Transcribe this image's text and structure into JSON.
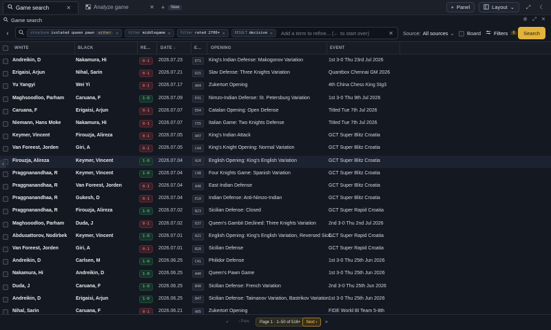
{
  "tabs": [
    {
      "label": "Game search",
      "active": true
    },
    {
      "label": "Analyze game",
      "active": false
    }
  ],
  "new_tab": {
    "plus": "+",
    "badge": "New"
  },
  "toolbar": {
    "panel_label": "Panel",
    "layout_label": "Layout"
  },
  "window": {
    "title": "Game search"
  },
  "search": {
    "chips": [
      {
        "key": "structure",
        "value": "isolated queen pawn",
        "mode": "either"
      },
      {
        "key": "filter",
        "value": "middlegame"
      },
      {
        "key": "filter",
        "value": "rated 2700+"
      },
      {
        "key": "RESULT",
        "value": "decisive"
      }
    ],
    "placeholder": "Add a term to refine... (← to start over)",
    "source_label": "Source:",
    "source_value": "All sources",
    "board_label": "Board",
    "filters_label": "Filters",
    "filters_count": "8",
    "search_button": "Search"
  },
  "columns": [
    "WHITE",
    "BLACK",
    "RE...",
    "DATE ↓",
    "E...",
    "OPENING",
    "EVENT"
  ],
  "rows": [
    {
      "white": "Andreikin, D",
      "black": "Nakamura, Hi",
      "result": "0-1",
      "date": "2026.07.23",
      "eco": "E71",
      "opening": "King's Indian Defense: Makogonov Variation",
      "event": "1st 3-0 Thu 23rd Jul 2026"
    },
    {
      "white": "Erigaisi, Arjun",
      "black": "Nihal, Sarin",
      "result": "0-1",
      "date": "2026.07.21",
      "eco": "D15",
      "opening": "Slav Defense: Three Knights Variation",
      "event": "Quantbox Chennai GM 2026"
    },
    {
      "white": "Yu Yangyi",
      "black": "Wei Yi",
      "result": "0-1",
      "date": "2026.07.17",
      "eco": "A04",
      "opening": "Zukertort Opening",
      "event": "4th China Chess King Stg3"
    },
    {
      "white": "Maghsoodloo, Parham",
      "black": "Caruana, F",
      "result": "1-0",
      "date": "2026.07.09",
      "eco": "E41",
      "opening": "Nimzo-Indian Defense: St. Petersburg Variation",
      "event": "1st 3-0 Thu 9th Jul 2026"
    },
    {
      "white": "Caruana, F",
      "black": "Erigaisi, Arjun",
      "result": "0-1",
      "date": "2026.07.07",
      "eco": "E04",
      "opening": "Catalan Opening: Open Defense",
      "event": "Titled Tue 7th Jul 2026"
    },
    {
      "white": "Niemann, Hans Moke",
      "black": "Nakamura, Hi",
      "result": "0-1",
      "date": "2026.07.07",
      "eco": "C55",
      "opening": "Italian Game: Two Knights Defense",
      "event": "Titled Tue 7th Jul 2026"
    },
    {
      "white": "Keymer, Vincent",
      "black": "Firouzja, Alireza",
      "result": "0-1",
      "date": "2026.07.05",
      "eco": "A07",
      "opening": "King's Indian Attack",
      "event": "GCT Super Blitz Croatia"
    },
    {
      "white": "Van Foreest, Jorden",
      "black": "Giri, A",
      "result": "0-1",
      "date": "2026.07.05",
      "eco": "C44",
      "opening": "King's Knight Opening: Normal Variation",
      "event": "GCT Super Blitz Croatia"
    },
    {
      "white": "Firouzja, Alireza",
      "black": "Keymer, Vincent",
      "result": "1-0",
      "date": "2026.07.04",
      "eco": "A20",
      "opening": "English Opening: King's English Variation",
      "event": "GCT Super Blitz Croatia"
    },
    {
      "white": "Praggnanandhaa, R",
      "black": "Keymer, Vincent",
      "result": "1-0",
      "date": "2026.07.04",
      "eco": "C48",
      "opening": "Four Knights Game: Spanish Variation",
      "event": "GCT Super Blitz Croatia"
    },
    {
      "white": "Praggnanandhaa, R",
      "black": "Van Foreest, Jorden",
      "result": "0-1",
      "date": "2026.07.04",
      "eco": "A48",
      "opening": "East Indian Defense",
      "event": "GCT Super Blitz Croatia"
    },
    {
      "white": "Praggnanandhaa, R",
      "black": "Gukesh, D",
      "result": "0-1",
      "date": "2026.07.04",
      "eco": "E10",
      "opening": "Indian Defense: Anti-Nimzo-Indian",
      "event": "GCT Super Blitz Croatia"
    },
    {
      "white": "Praggnanandhaa, R",
      "black": "Firouzja, Alireza",
      "result": "1-0",
      "date": "2026.07.02",
      "eco": "B23",
      "opening": "Sicilian Defense: Closed",
      "event": "GCT Super Rapid Croatia"
    },
    {
      "white": "Maghsoodloo, Parham",
      "black": "Duda, J",
      "result": "0-1",
      "date": "2026.07.02",
      "eco": "D37",
      "opening": "Queen's Gambit Declined: Three Knights Variation",
      "event": "2nd 3-0 Thu 2nd Jul 2026"
    },
    {
      "white": "Abdusattorov, Nodirbek",
      "black": "Keymer, Vincent",
      "result": "1-0",
      "date": "2026.07.01",
      "eco": "A21",
      "opening": "English Opening: King's English Variation, Reversed Sicil...",
      "event": "GCT Super Rapid Croatia"
    },
    {
      "white": "Van Foreest, Jorden",
      "black": "Giri, A",
      "result": "0-1",
      "date": "2026.07.01",
      "eco": "B20",
      "opening": "Sicilian Defense",
      "event": "GCT Super Rapid Croatia"
    },
    {
      "white": "Andreikin, D",
      "black": "Carlsen, M",
      "result": "1-0",
      "date": "2026.06.25",
      "eco": "C41",
      "opening": "Philidor Defense",
      "event": "1st 3-0 Thu 25th Jun 2026"
    },
    {
      "white": "Nakamura, Hi",
      "black": "Andreikin, D",
      "result": "1-0",
      "date": "2026.06.25",
      "eco": "A40",
      "opening": "Queen's Pawn Game",
      "event": "1st 3-0 Thu 25th Jun 2026"
    },
    {
      "white": "Duda, J",
      "black": "Caruana, F",
      "result": "1-0",
      "date": "2026.06.25",
      "eco": "B40",
      "opening": "Sicilian Defense: French Variation",
      "event": "2nd 3-0 Thu 25th Jun 2026"
    },
    {
      "white": "Andreikin, D",
      "black": "Erigaisi, Arjun",
      "result": "1-0",
      "date": "2026.06.25",
      "eco": "B47",
      "opening": "Sicilian Defense: Taimanov Variation, Bastrikov Variation",
      "event": "1st 3-0 Thu 25th Jun 2026"
    },
    {
      "white": "Nihal, Sarin",
      "black": "Caruana, F",
      "result": "0-1",
      "date": "2026.06.21",
      "eco": "A05",
      "opening": "Zukertort Opening",
      "event": "FIDE World Bl Team 5-8th"
    }
  ],
  "pagination": {
    "first": "«",
    "prev": "‹ Prev",
    "info": "Page 1 · 1–50 of 516+",
    "next": "Next ›",
    "last": "»"
  },
  "icons": {
    "search": "search-icon",
    "close": "close-icon",
    "plus": "plus-icon",
    "layout": "layout-icon",
    "expand": "expand-icon",
    "theme": "moon-icon",
    "filters": "sliders-icon"
  },
  "colors": {
    "accent": "#e3b43a",
    "loss": "#ec8b94",
    "win": "#7fd3a7",
    "background": "#141821"
  }
}
